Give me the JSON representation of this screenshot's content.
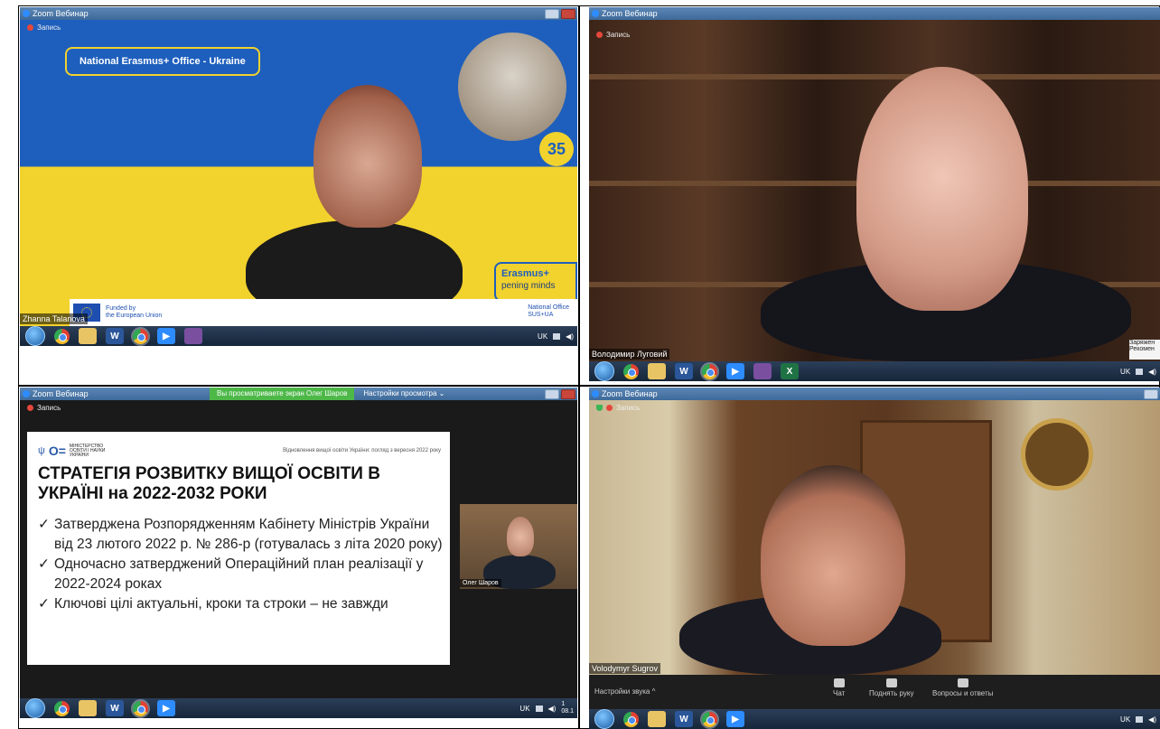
{
  "panels": {
    "top_left": {
      "title": "Zoom Вебинар",
      "recording": "Запись",
      "banner": "National Erasmus+ Office - Ukraine",
      "erasmus_logo": "Erasmus+",
      "erasmus_tagline": "pening minds",
      "funded": "Funded by\nthe European Union",
      "office_small": "National Office\nSUS+UA",
      "anniversary": "35",
      "speaker": "Zhanna Talanova",
      "tray": "UK"
    },
    "top_right": {
      "title": "Zoom Вебинар",
      "recording": "Запись",
      "speaker": "Володимир Луговий",
      "tooltip": "Заряжен\nРекомен",
      "tray": "UK"
    },
    "bottom_left": {
      "title": "Zoom Вебинар",
      "share_notice": "Вы просматриваете экран Олег Шаров",
      "view_settings": "Настройки просмотра",
      "recording": "Запись",
      "ministry": "МІНІСТЕРСТВО\nОСВІТИ І НАУКИ\nУКРАЇНИ",
      "slide_subtitle": "Відновлення вищої освіти України: погляд з вересня 2022 року",
      "slide_title": "СТРАТЕГІЯ РОЗВИТКУ ВИЩОЇ ОСВІТИ В УКРАЇНІ на 2022-2032 РОКИ",
      "bullets": [
        "Затверджена Розпорядженням Кабінету Міністрів України від 23 лютого 2022 р. № 286-р (готувалась з літа 2020 року)",
        "Одночасно затверджений Операційний план реалізації у 2022-2024 роках",
        "Ключові цілі актуальні, кроки та строки – не завжди"
      ],
      "thumb_name": "Олег Шаров",
      "tray": "UK",
      "clock": "1\n08.1"
    },
    "bottom_right": {
      "title": "Zoom Вебинар",
      "recording": "Запись",
      "speaker": "Volodymyr Sugrov",
      "sound_settings": "Настройки звука",
      "controls": [
        "Чат",
        "Поднять руку",
        "Вопросы и ответы"
      ],
      "tray": "UK"
    }
  }
}
